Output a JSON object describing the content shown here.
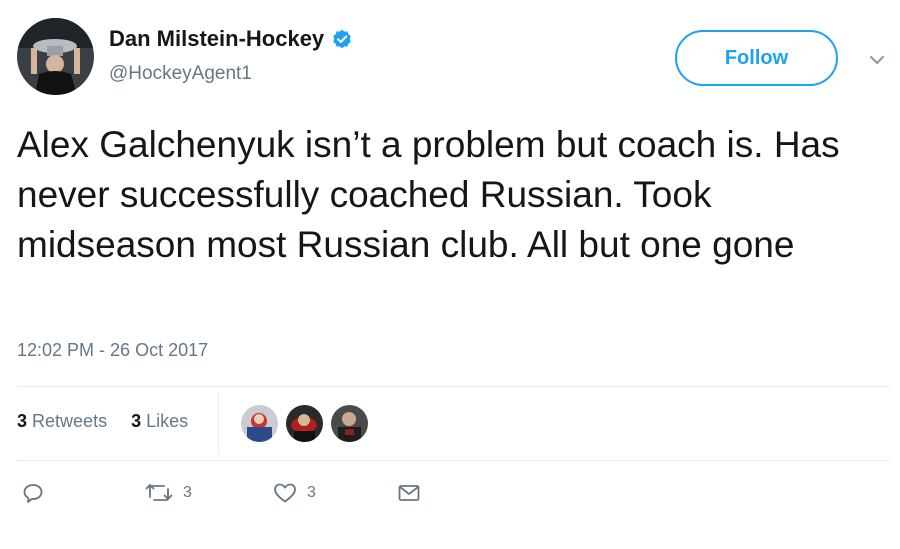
{
  "author": {
    "display_name": "Dan Milstein-Hockey",
    "handle": "@HockeyAgent1",
    "verified": true
  },
  "follow_label": "Follow",
  "tweet_text": "Alex Galchenyuk isn’t a problem but coach is. Has never successfully coached Russian. Took midseason most Russian club. All but one gone",
  "timestamp": "12:02 PM - 26 Oct 2017",
  "stats": {
    "retweets_count": "3",
    "retweets_label": "Retweets",
    "likes_count": "3",
    "likes_label": "Likes"
  },
  "actions": {
    "reply_count": "",
    "retweet_count": "3",
    "like_count": "3"
  },
  "colors": {
    "accent": "#1da1f2",
    "muted": "#657786",
    "text": "#14171a",
    "divider": "#e6ecf0"
  },
  "icons": [
    "avatar",
    "verified-badge-icon",
    "chevron-down-icon",
    "reply-icon",
    "retweet-icon",
    "heart-icon",
    "envelope-icon"
  ]
}
